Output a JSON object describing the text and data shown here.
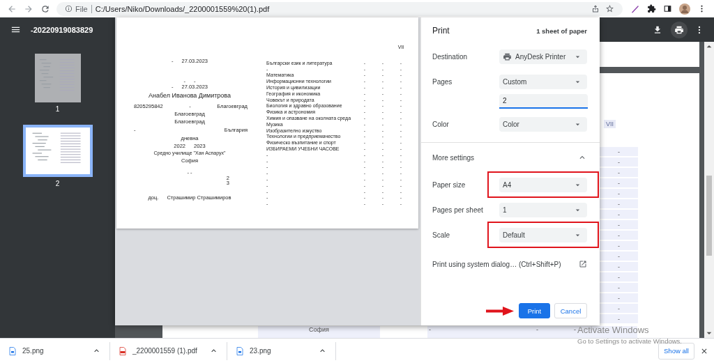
{
  "browser": {
    "scheme": "File",
    "url": "C:/Users/Niko/Downloads/_2200001559%20(1).pdf"
  },
  "pdf_viewer": {
    "title": "-20220919083829",
    "thumbnails": [
      {
        "label": "1",
        "selected": false
      },
      {
        "label": "2",
        "selected": true
      }
    ],
    "page": {
      "column_header": "VII",
      "cells": [
        "-",
        "-",
        "-",
        "-",
        "-",
        "-",
        "-",
        "-",
        "-",
        "-",
        "-",
        "-",
        "-",
        "-",
        "-",
        "-",
        "-"
      ],
      "bottom_row": [
        "София",
        "-",
        "-",
        "-"
      ]
    }
  },
  "print_dialog": {
    "preview": {
      "lines": [
        {
          "kind": "center",
          "parts": [
            "-",
            "27.03.2023"
          ]
        },
        {
          "kind": "center",
          "parts": [
            "-",
            "-"
          ]
        },
        {
          "kind": "center",
          "parts": [
            "-",
            "27.03.2023"
          ]
        },
        {
          "kind": "title",
          "parts": [
            "Анабел Иванова Димитрова"
          ]
        },
        {
          "kind": "spread",
          "parts": [
            "8205295842",
            "-",
            "Благоевград"
          ]
        },
        {
          "kind": "center",
          "parts": [
            "Благоевград"
          ]
        },
        {
          "kind": "center",
          "parts": [
            "Благоевград"
          ]
        },
        {
          "kind": "spread",
          "parts": [
            "-",
            "България"
          ]
        },
        {
          "kind": "center",
          "parts": [
            "дневна"
          ]
        },
        {
          "kind": "center",
          "parts": [
            "2022",
            "2023"
          ]
        },
        {
          "kind": "small",
          "parts": [
            "Средно училище \"Хан Аспарух\""
          ]
        },
        {
          "kind": "center",
          "parts": [
            "София"
          ]
        },
        {
          "kind": "center",
          "parts": [
            "- -"
          ]
        },
        {
          "kind": "right",
          "parts": [
            "2"
          ]
        },
        {
          "kind": "right",
          "parts": [
            "3"
          ]
        },
        {
          "kind": "center",
          "parts": [
            "доц.",
            "Страшимир Страшимиров"
          ]
        }
      ],
      "table_header": "VII",
      "subjects": [
        {
          "name": "Български език и литература",
          "marks": [
            "-",
            "-",
            "-"
          ]
        },
        {
          "name": "-",
          "marks": [
            "-",
            "-",
            "-"
          ]
        },
        {
          "name": "Математика",
          "marks": [
            "-",
            "-",
            "-"
          ]
        },
        {
          "name": "Информационни технологии",
          "marks": [
            "-",
            "-",
            "-"
          ]
        },
        {
          "name": "История и цивилизации",
          "marks": [
            "-",
            "-",
            "-"
          ]
        },
        {
          "name": "География и икономика",
          "marks": [
            "-",
            "-",
            "-"
          ]
        },
        {
          "name": "Човекът и природата",
          "marks": [
            "-",
            "-",
            "-"
          ]
        },
        {
          "name": "Биология и здравно образование",
          "marks": [
            "-",
            "-",
            "-"
          ]
        },
        {
          "name": "Физика и астрономия",
          "marks": [
            "-",
            "-",
            "-"
          ]
        },
        {
          "name": "Химия и опазване на околната среда",
          "marks": [
            "-",
            "-",
            "-"
          ]
        },
        {
          "name": "Музика",
          "marks": [
            "-",
            "-",
            "-"
          ]
        },
        {
          "name": "Изобразително изкуство",
          "marks": [
            "-",
            "-",
            "-"
          ]
        },
        {
          "name": "Технологии и предприемачество",
          "marks": [
            "-",
            "-",
            "-"
          ]
        },
        {
          "name": "Физическо възпитание и спорт",
          "marks": [
            "-",
            "-",
            "-"
          ]
        },
        {
          "name": "ИЗБИРАЕМИ УЧЕБНИ ЧАСОВЕ",
          "marks": [
            "-",
            "-",
            "-"
          ]
        },
        {
          "name": "-",
          "marks": [
            "-",
            "-",
            "-"
          ]
        },
        {
          "name": "-",
          "marks": [
            "-",
            "-",
            "-"
          ]
        },
        {
          "name": "-",
          "marks": [
            "-",
            "-",
            "-"
          ]
        },
        {
          "name": "-",
          "marks": [
            "-",
            "-",
            "-"
          ]
        },
        {
          "name": "-",
          "marks": [
            "-",
            "-",
            "-"
          ]
        },
        {
          "name": "-",
          "marks": [
            "-",
            "-",
            "-"
          ]
        },
        {
          "name": "-",
          "marks": [
            "-",
            "-",
            "-"
          ]
        },
        {
          "name": "-",
          "marks": [
            "-",
            "-",
            "-"
          ]
        },
        {
          "name": "-",
          "marks": [
            "-",
            "-",
            "-"
          ]
        }
      ]
    },
    "title": "Print",
    "sheet_count": "1 sheet of paper",
    "settings": [
      {
        "kind": "select",
        "label": "Destination",
        "value": "AnyDesk Printer",
        "printer_icon": true,
        "highlighted": false
      },
      {
        "kind": "select",
        "label": "Pages",
        "value": "Custom",
        "highlighted": false
      },
      {
        "kind": "input",
        "value": "2"
      },
      {
        "kind": "select",
        "label": "Color",
        "value": "Color",
        "highlighted": false
      },
      {
        "kind": "section",
        "label": "More settings",
        "expanded": true
      },
      {
        "kind": "select",
        "label": "Paper size",
        "value": "A4",
        "highlighted": true
      },
      {
        "kind": "select",
        "label": "Pages per sheet",
        "value": "1",
        "highlighted": false
      },
      {
        "kind": "select",
        "label": "Scale",
        "value": "Default",
        "highlighted": true
      },
      {
        "kind": "link",
        "label": "Print using system dialog… (Ctrl+Shift+P)"
      }
    ],
    "buttons": [
      {
        "kind": "primary",
        "label": "Print",
        "pointed": true
      },
      {
        "kind": "secondary",
        "label": "Cancel",
        "pointed": false
      }
    ]
  },
  "downloads": {
    "items": [
      {
        "kind": "image",
        "name": "25.png"
      },
      {
        "kind": "pdf",
        "name": "_2200001559 (1).pdf"
      },
      {
        "kind": "image",
        "name": "23.png"
      }
    ],
    "show_all": "Show all"
  },
  "system_notice": {
    "title": "Activate Windows",
    "text": "Go to Settings to activate Windows."
  }
}
